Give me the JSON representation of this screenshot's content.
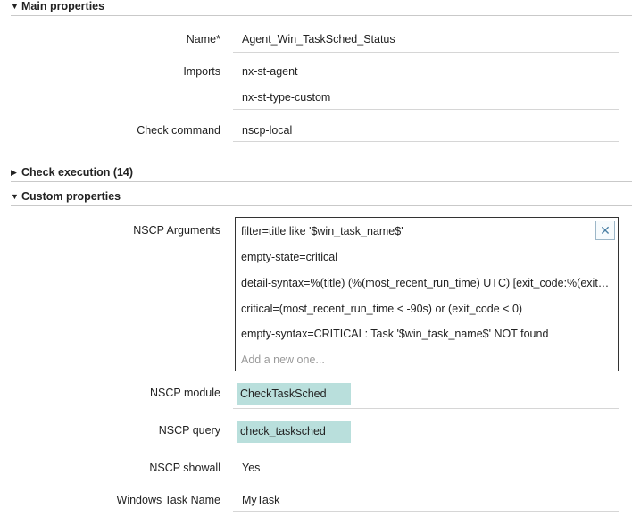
{
  "sections": {
    "main": {
      "title": "Main properties",
      "expanded": true
    },
    "check_execution": {
      "title": "Check execution (14)",
      "expanded": false
    },
    "custom": {
      "title": "Custom properties",
      "expanded": true
    }
  },
  "fields": {
    "name": {
      "label": "Name*",
      "value": "Agent_Win_TaskSched_Status"
    },
    "imports": {
      "label": "Imports",
      "values": [
        "nx-st-agent",
        "nx-st-type-custom"
      ]
    },
    "check_command": {
      "label": "Check command",
      "value": "nscp-local"
    },
    "nscp_arguments": {
      "label": "NSCP Arguments",
      "values": [
        "filter=title like '$win_task_name$'",
        "empty-state=critical",
        "detail-syntax=%(title) (%(most_recent_run_time) UTC) [exit_code:%(exit_code)]",
        "critical=(most_recent_run_time < -90s) or (exit_code < 0)",
        "empty-syntax=CRITICAL: Task '$win_task_name$' NOT found"
      ],
      "placeholder": "Add a new one...",
      "remove_icon": "close-icon"
    },
    "nscp_module": {
      "label": "NSCP module",
      "value": "CheckTaskSched"
    },
    "nscp_query": {
      "label": "NSCP query",
      "value": "check_tasksched"
    },
    "nscp_showall": {
      "label": "NSCP showall",
      "value": "Yes"
    },
    "windows_task_name": {
      "label": "Windows Task Name",
      "value": "MyTask"
    }
  },
  "colors": {
    "chip_bg": "#b9dfdc",
    "accent": "#4a7fa4"
  }
}
